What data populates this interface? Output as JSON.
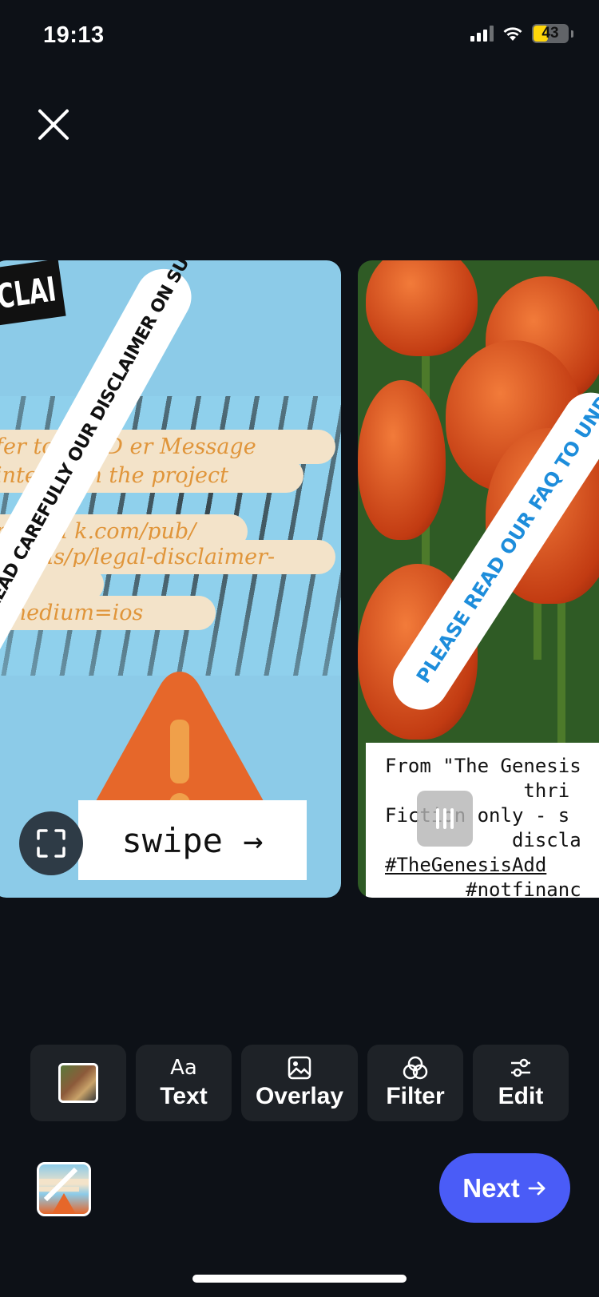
{
  "status_bar": {
    "time": "19:13",
    "battery": "43",
    "battery_level": 0.43
  },
  "close": {
    "icon": "close-icon"
  },
  "slides": [
    {
      "tag_text": "CLAI",
      "sticker_text": "SE READ CAREFULLY OUR DISCLAIMER ON SUBSTACK",
      "bubbles": [
        "fer to our D         er Message",
        "interactin        the project",
        "nen.su        k.com/pub/",
        "sen         us/p/legal-disclaimer-",
        "        ?",
        "        _medium=ios"
      ],
      "banner_text": "swipe →"
    },
    {
      "sticker_text": "PLEASE READ OUR FAQ TO UNDER",
      "caption_lines": [
        "From \"The Genesis",
        "            thri",
        "Fiction only - s",
        "           discla",
        "#TheGenesisAdd",
        "       #notfinanc"
      ]
    }
  ],
  "toolbar": {
    "text_icon": "Aa",
    "text_label": "Text",
    "overlay_label": "Overlay",
    "filter_label": "Filter",
    "edit_label": "Edit"
  },
  "next_button": {
    "label": "Next",
    "icon": "arrow-right-icon"
  },
  "colors": {
    "background": "#0d1117",
    "accent": "#4a5cf7",
    "tool_bg": "#1e2227"
  }
}
